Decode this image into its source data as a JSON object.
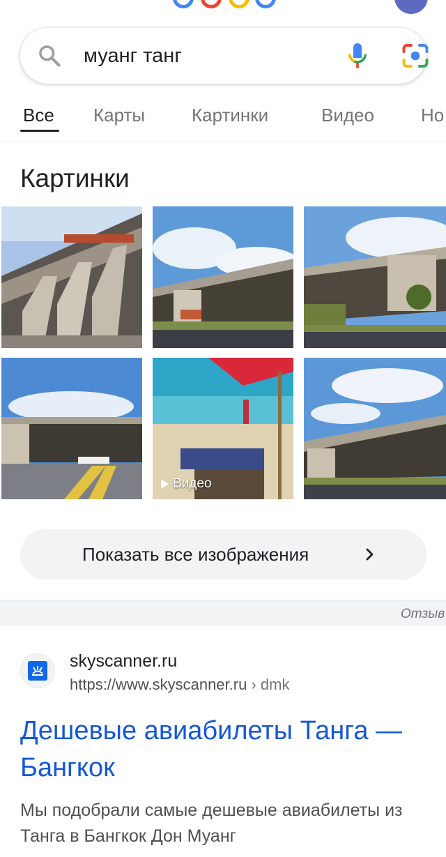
{
  "search": {
    "query": "муанг танг"
  },
  "tabs": [
    {
      "label": "Все",
      "active": true
    },
    {
      "label": "Карты",
      "active": false
    },
    {
      "label": "Картинки",
      "active": false
    },
    {
      "label": "Видео",
      "active": false
    },
    {
      "label": "Но",
      "active": false
    }
  ],
  "images_section": {
    "title": "Картинки",
    "video_badge": "Видео",
    "show_all_label": "Показать все изображения"
  },
  "feedback_label": "Отзыв",
  "result": {
    "site_name": "skyscanner.ru",
    "url": "https://www.skyscanner.ru",
    "url_crumb": " › dmk",
    "title": "Дешевые авиабилеты Танга — Бангкок",
    "snippet": "Мы подобрали самые дешевые авиабилеты из Танга в Бангкок Дон Муанг"
  },
  "colors": {
    "link": "#1558d6",
    "accent_blue": "#4285f4",
    "accent_red": "#ea4335",
    "accent_yellow": "#fbbc05",
    "accent_green": "#34a853"
  }
}
